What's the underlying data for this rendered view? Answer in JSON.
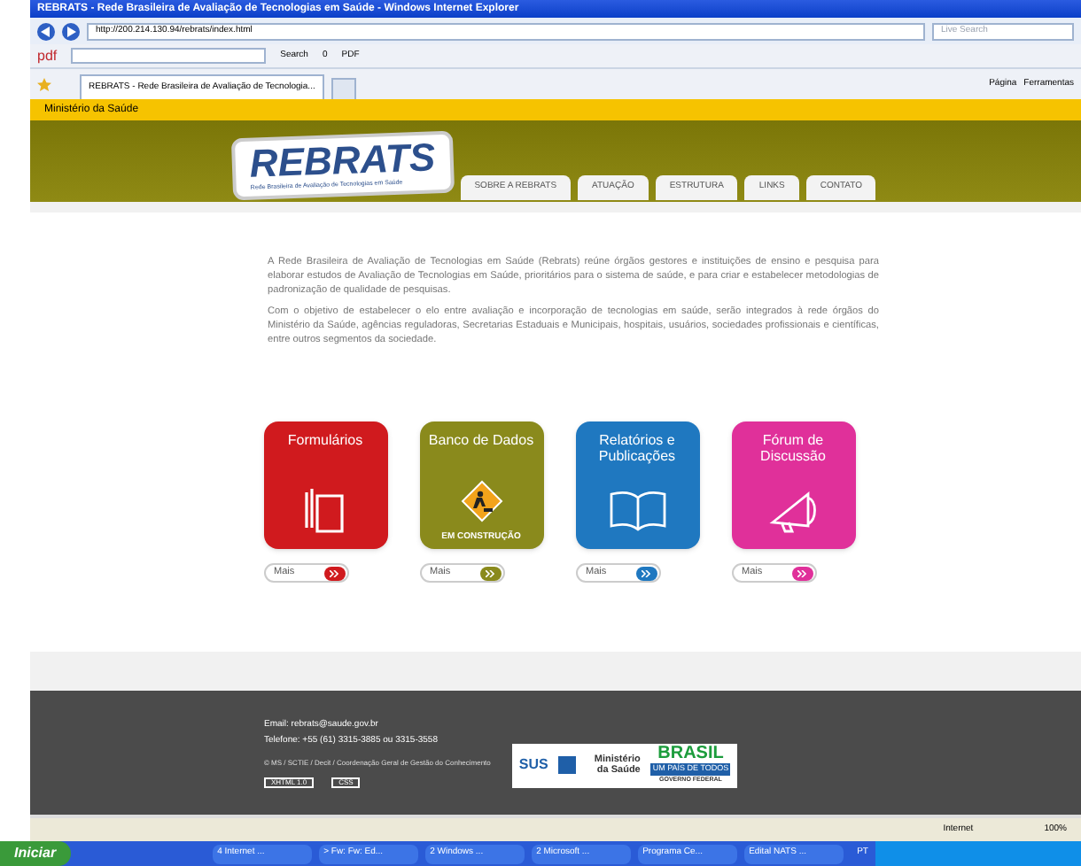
{
  "window": {
    "title": "REBRATS - Rede Brasileira de Avaliação de Tecnologias em Saúde - Windows Internet Explorer"
  },
  "address_bar": {
    "url": "http://200.214.130.94/rebrats/index.html",
    "search_placeholder": "Live Search"
  },
  "pdf_toolbar": {
    "label": "pdf",
    "search": "Search",
    "count": "0",
    "pdf": "PDF"
  },
  "tabs": [
    {
      "label": "REBRATS - Rede Brasileira de Avaliação de Tecnologia...",
      "selected": true
    }
  ],
  "command_bar": [
    "Página",
    "Ferramentas"
  ],
  "gov_bar": {
    "label": "Ministério da Saúde"
  },
  "site": {
    "logo": "REBRATS",
    "logo_subtitle": "Rede Brasileira de Avaliação de Tecnologias em Saúde",
    "nav": [
      {
        "label": "SOBRE A REBRATS"
      },
      {
        "label": "ATUAÇÃO"
      },
      {
        "label": "ESTRUTURA"
      },
      {
        "label": "LINKS"
      },
      {
        "label": "CONTATO"
      }
    ],
    "paragraphs": [
      "A Rede Brasileira de Avaliação de Tecnologias em Saúde (Rebrats) reúne órgãos gestores e instituições de ensino e pesquisa para elaborar estudos de Avaliação de Tecnologias em Saúde, prioritários para o sistema de saúde, e para criar e estabelecer metodologias de padronização de qualidade de pesquisas.",
      "Com o objetivo de estabelecer o elo entre avaliação e incorporação de tecnologias em saúde, serão integrados à rede órgãos do Ministério da Saúde, agências reguladoras, Secretarias Estaduais e Municipais, hospitais, usuários, sociedades profissionais e científicas, entre outros segmentos da sociedade."
    ],
    "cards": [
      {
        "kind": "forms",
        "title": "Formulários",
        "color": "#d01a1e",
        "more": "Mais"
      },
      {
        "kind": "construction",
        "title": "Banco de Dados",
        "color": "#8a8a1c",
        "footer": "EM CONSTRUÇÃO",
        "more": "Mais"
      },
      {
        "kind": "book",
        "title": "Relatórios e Publicações",
        "color": "#1f78c0",
        "more": "Mais"
      },
      {
        "kind": "megaphone",
        "title": "Fórum de Discussão",
        "color": "#e0309a",
        "more": "Mais"
      }
    ],
    "footer": {
      "email": "Email: rebrats@saude.gov.br",
      "phone": "Telefone: +55 (61) 3315-3885 ou 3315-3558",
      "credits": "© MS / SCTIE / Decit / Coordenação Geral de Gestão do Conhecimento",
      "badges": [
        "XHTML 1.0",
        "CSS"
      ],
      "sus": "SUS",
      "ministry": "Ministério da Saúde",
      "brasil": "BRASIL",
      "brasil_tag": "UM PAÍS DE TODOS",
      "gov": "GOVERNO FEDERAL"
    }
  },
  "status_bar": {
    "zone": "Internet",
    "zoom": "100%"
  },
  "taskbar": {
    "start": "Iniciar",
    "items": [
      "4 Internet ...",
      "> Fw: Fw: Ed...",
      "2 Windows ...",
      "2 Microsoft ...",
      "Programa Ce...",
      "Edital NATS ..."
    ],
    "lang": "PT"
  }
}
